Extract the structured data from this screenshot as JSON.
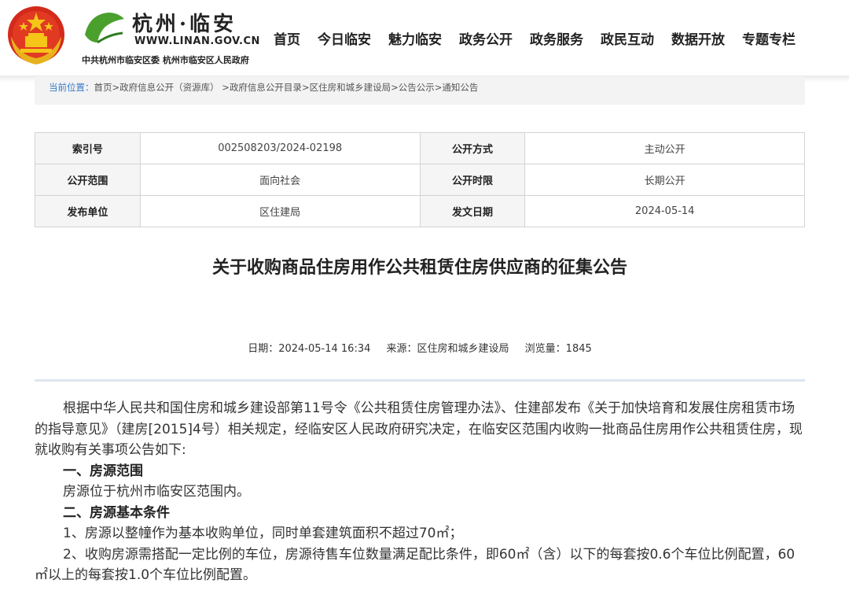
{
  "header": {
    "site_title": "杭州·临安",
    "site_url": "WWW.LINAN.GOV.CN",
    "site_sub": "中共杭州市临安区委   杭州市临安区人民政府",
    "nav": [
      "首页",
      "今日临安",
      "魅力临安",
      "政务公开",
      "政务服务",
      "政民互动",
      "数据开放",
      "专题专栏"
    ]
  },
  "breadcrumb": {
    "label": "当前位置：",
    "items": [
      "首页",
      "政府信息公开（资源库）",
      "政府信息公开目录",
      "区住房和城乡建设局",
      "公告公示",
      "通知公告"
    ],
    "sep": ">"
  },
  "info": {
    "rows": [
      {
        "k1": "索引号",
        "v1": "002508203/2024-02198",
        "k2": "公开方式",
        "v2": "主动公开"
      },
      {
        "k1": "公开范围",
        "v1": "面向社会",
        "k2": "公开时限",
        "v2": "长期公开"
      },
      {
        "k1": "发布单位",
        "v1": "区住建局",
        "k2": "发文日期",
        "v2": "2024-05-14"
      }
    ]
  },
  "article": {
    "title": "关于收购商品住房用作公共租赁住房供应商的征集公告",
    "date": "日期：2024-05-14   16:34",
    "source": "来源：区住房和城乡建设局",
    "views": "浏览量：1845",
    "intro": "根据中华人民共和国住房和城乡建设部第11号令《公共租赁住房管理办法》、住建部发布《关于加快培育和发展住房租赁市场的指导意见》（建房[2015]4号）相关规定，经临安区人民政府研究决定，在临安区范围内收购一批商品住房用作公共租赁住房，现就收购有关事项公告如下:",
    "h1": "一、房源范围",
    "p1": "房源位于杭州市临安区范围内。",
    "h2": "二、房源基本条件",
    "p2": "1、房源以整幢作为基本收购单位，同时单套建筑面积不超过70㎡；",
    "p3": "2、收购房源需搭配一定比例的车位，房源待售车位数量满足配比条件，即60㎡（含）以下的每套按0.6个车位比例配置，60㎡以上的每套按1.0个车位比例配置。"
  }
}
